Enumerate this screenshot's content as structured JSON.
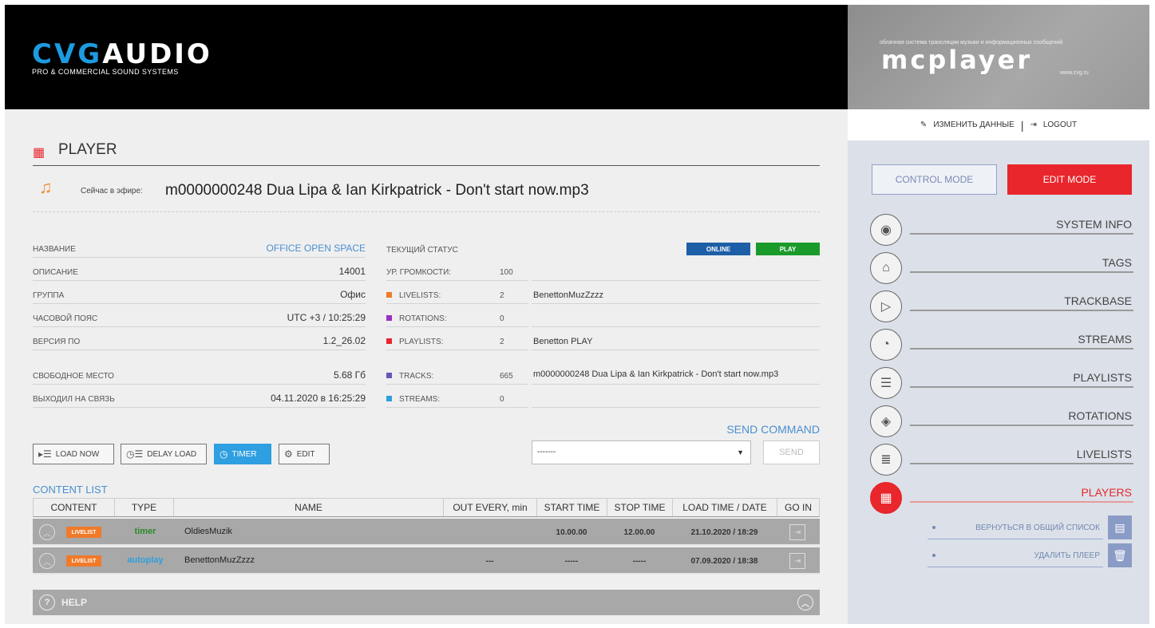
{
  "header": {
    "logo_cvg": "CVG",
    "logo_audio": "AUDIO",
    "logo_tagline": "PRO & COMMERCIAL SOUND SYSTEMS",
    "right_tagline": "облачная система трансляции музыки и информационных сообщений",
    "right_logo": "mcplayer",
    "right_url": "www.cvg.ru"
  },
  "userbar": {
    "edit_label": "ИЗМЕНИТЬ ДАННЫЕ",
    "logout_label": "LOGOUT"
  },
  "sidebar": {
    "control_mode": "CONTROL MODE",
    "edit_mode": "EDIT MODE",
    "items": [
      {
        "label": "SYSTEM INFO",
        "icon": "eye-icon"
      },
      {
        "label": "TAGS",
        "icon": "tag-icon"
      },
      {
        "label": "TRACKBASE",
        "icon": "music-file-icon"
      },
      {
        "label": "STREAMS",
        "icon": "stream-file-icon"
      },
      {
        "label": "PLAYLISTS",
        "icon": "list-icon"
      },
      {
        "label": "ROTATIONS",
        "icon": "layers-icon"
      },
      {
        "label": "LIVELISTS",
        "icon": "livelist-icon"
      },
      {
        "label": "PLAYERS",
        "icon": "player-icon"
      }
    ],
    "sub_items": [
      {
        "label": "ВЕРНУТЬСЯ В ОБЩИЙ СПИСОК",
        "icon": "store-icon"
      },
      {
        "label": "УДАЛИТЬ ПЛЕЕР",
        "icon": "trash-icon"
      }
    ]
  },
  "page": {
    "title": "PLAYER",
    "now_playing_label": "Сейчас в эфире:",
    "now_playing_value": "m0000000248 Dua Lipa & Ian Kirkpatrick - Don't start now.mp3"
  },
  "info": [
    {
      "key": "НАЗВАНИЕ",
      "value": "OFFICE OPEN SPACE"
    },
    {
      "key": "ОПИСАНИЕ",
      "value": "14001"
    },
    {
      "key": "ГРУППА",
      "value": "Офис"
    },
    {
      "key": "ЧАСОВОЙ ПОЯС",
      "value": "UTC +3 / 10:25:29"
    },
    {
      "key": "ВЕРСИЯ ПО",
      "value": "1.2_26.02"
    },
    {
      "key": "СВОБОДНОЕ МЕСТО",
      "value": "5.68 Гб"
    },
    {
      "key": "ВЫХОДИЛ НА СВЯЗЬ",
      "value": "04.11.2020 в 16:25:29"
    }
  ],
  "status": {
    "header": "ТЕКУЩИЙ СТАТУС",
    "badge_online": "ONLINE",
    "badge_play": "PLAY",
    "rows": [
      {
        "key": "УР. ГРОМКОСТИ:",
        "value": "100",
        "color": "",
        "detail": ""
      },
      {
        "key": "LIVELISTS:",
        "value": "2",
        "color": "#f07a2a",
        "detail": "BenettonMuzZzzz"
      },
      {
        "key": "ROTATIONS:",
        "value": "0",
        "color": "#9b2fc0",
        "detail": ""
      },
      {
        "key": "PLAYLISTS:",
        "value": "2",
        "color": "#e8262c",
        "detail": "Benetton PLAY"
      },
      {
        "key": "TRACKS:",
        "value": "665",
        "color": "#6a55b8",
        "detail": "m0000000248 Dua Lipa & Ian Kirkpatrick - Don't start now.mp3"
      },
      {
        "key": "STREAMS:",
        "value": "0",
        "color": "#2e9fe0",
        "detail": ""
      }
    ]
  },
  "toolbar": {
    "load_now": "LOAD NOW",
    "delay_load": "DELAY LOAD",
    "timer": "TIMER",
    "edit": "EDIT",
    "send_command": "SEND COMMAND",
    "select_value": "-------",
    "send": "SEND"
  },
  "content": {
    "label": "CONTENT LIST",
    "columns": [
      "CONTENT",
      "TYPE",
      "NAME",
      "OUT EVERY, min",
      "START TIME",
      "STOP TIME",
      "LOAD TIME / DATE",
      "GO IN"
    ],
    "rows": [
      {
        "badge": "LIVELIST",
        "type": "timer",
        "type_color": "#2a8a2a",
        "name": "OldiesMuzik",
        "out_every": "",
        "start": "10.00.00",
        "stop": "12.00.00",
        "load": "21.10.2020 / 18:29"
      },
      {
        "badge": "LIVELIST",
        "type": "autoplay",
        "type_color": "#2e9fe0",
        "name": "BenettonMuzZzzz",
        "out_every": "---",
        "start": "-----",
        "stop": "-----",
        "load": "07.09.2020 / 18:38"
      }
    ]
  },
  "help": {
    "label": "HELP"
  }
}
